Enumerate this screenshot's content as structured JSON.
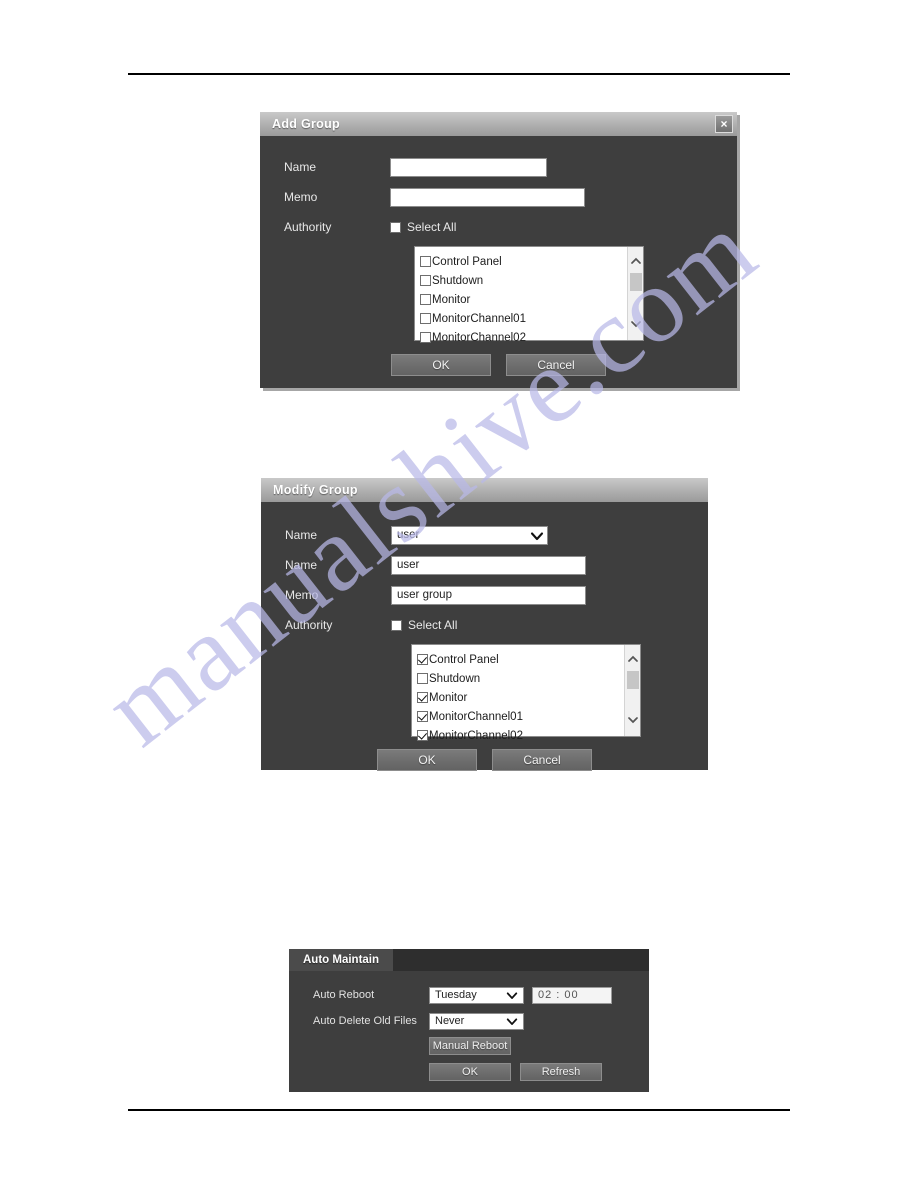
{
  "page": {
    "watermark_text": "manualshive.com",
    "rule_color": "#000000"
  },
  "add_group_dialog": {
    "title": "Add Group",
    "close_icon_label": "×",
    "fields": {
      "name_label": "Name",
      "name_value": "",
      "memo_label": "Memo",
      "memo_value": "",
      "authority_label": "Authority",
      "select_all_label": "Select All",
      "select_all_checked": false
    },
    "authority_items": [
      {
        "label": "Control Panel",
        "checked": false
      },
      {
        "label": "Shutdown",
        "checked": false
      },
      {
        "label": "Monitor",
        "checked": false
      },
      {
        "label": "MonitorChannel01",
        "checked": false
      },
      {
        "label": "MonitorChannel02",
        "checked": false
      }
    ],
    "buttons": {
      "ok": "OK",
      "cancel": "Cancel"
    }
  },
  "modify_group_dialog": {
    "title": "Modify Group",
    "fields": {
      "group_select_label": "Name",
      "group_select_value": "user",
      "name_label": "Name",
      "name_value": "user",
      "memo_label": "Memo",
      "memo_value": "user group",
      "authority_label": "Authority",
      "select_all_label": "Select All",
      "select_all_checked": false
    },
    "authority_items": [
      {
        "label": "Control Panel",
        "checked": true
      },
      {
        "label": "Shutdown",
        "checked": false
      },
      {
        "label": "Monitor",
        "checked": true
      },
      {
        "label": "MonitorChannel01",
        "checked": true
      },
      {
        "label": "MonitorChannel02",
        "checked": true
      }
    ],
    "buttons": {
      "ok": "OK",
      "cancel": "Cancel"
    }
  },
  "auto_maintain_dialog": {
    "tab_label": "Auto Maintain",
    "auto_reboot_label": "Auto Reboot",
    "auto_reboot_day": "Tuesday",
    "auto_reboot_time": "02 : 00",
    "auto_delete_label": "Auto Delete Old Files",
    "auto_delete_value": "Never",
    "buttons": {
      "manual_reboot": "Manual Reboot",
      "ok": "OK",
      "refresh": "Refresh"
    }
  }
}
